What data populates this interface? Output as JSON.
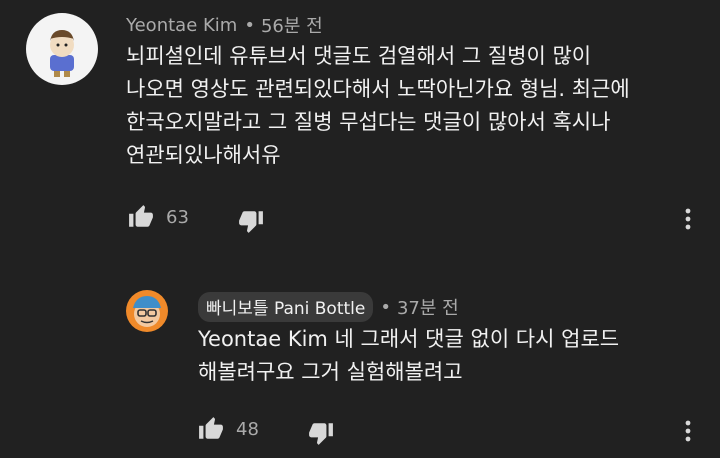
{
  "comments": [
    {
      "author": "Yeontae Kim",
      "time": "56분 전",
      "lines": [
        "뇌피셜인데 유튜브서 댓글도 검열해서 그 질병이 많이",
        "나오면 영상도 관련되있다해서 노딱아닌가요 형님. 최근에",
        "한국오지말라고 그 질병 무섭다는 댓글이 많아서 혹시나",
        "연관되있나해서유"
      ],
      "likes": "63",
      "icons": {
        "avatar": "cartoon-avatar",
        "like": "thumbs-up-icon",
        "dislike": "thumbs-down-icon",
        "menu": "more-vert-icon"
      }
    },
    {
      "author": "빠니보틀 Pani Bottle",
      "time": "37분 전",
      "lines": [
        "Yeontae Kim 네 그래서 댓글 없이 다시 업로드",
        "해볼려구요 그거 실험해볼려고"
      ],
      "likes": "48",
      "icons": {
        "avatar": "cartoon-avatar",
        "like": "thumbs-up-icon",
        "dislike": "thumbs-down-icon",
        "menu": "more-vert-icon"
      }
    }
  ],
  "separator": "•",
  "colors": {
    "background": "#212121",
    "text_primary": "#f1f1f1",
    "text_secondary": "#aaaaaa",
    "author_chip": "#3a3a3a"
  }
}
